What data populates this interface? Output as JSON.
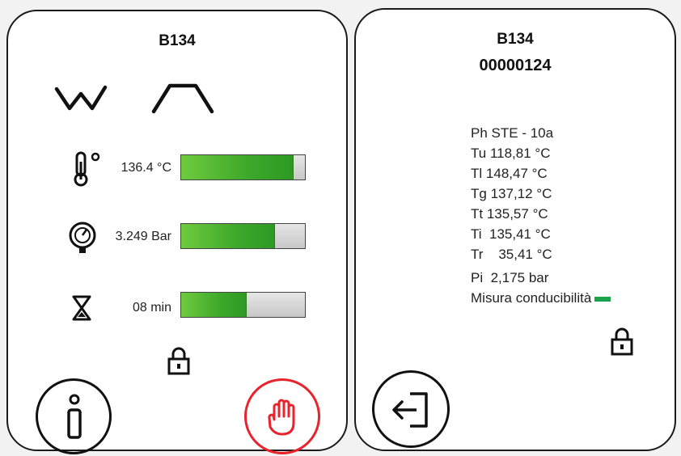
{
  "left_panel": {
    "title": "B134",
    "temperature": {
      "value_text": "136.4 °C",
      "level": 0.9
    },
    "pressure": {
      "value_text": "3.249 Bar",
      "level": 0.75
    },
    "time": {
      "value_text": "08 min",
      "level": 0.52
    },
    "icons": {
      "cycle_wave": "wave-icon",
      "cycle_profile": "trapezoid-profile-icon",
      "thermometer": "thermometer-icon",
      "manometer": "pressure-gauge-icon",
      "hourglass": "hourglass-icon",
      "lock": "padlock-icon",
      "info": "info-icon",
      "stop": "stop-hand-icon"
    },
    "colors": {
      "stop_red": "#e8232c",
      "bar_green": "#3da82a"
    }
  },
  "right_panel": {
    "title": "B134",
    "cycle_number": "00000124",
    "rows": [
      {
        "label": "Ph",
        "value": "STE - 10a"
      },
      {
        "label": "Tu",
        "value": "118,81 °C"
      },
      {
        "label": "Tl",
        "value": "148,47 °C"
      },
      {
        "label": "Tg",
        "value": "137,12 °C"
      },
      {
        "label": "Tt",
        "value": "135,57 °C"
      },
      {
        "label": "Ti",
        "value": " 135,41 °C"
      },
      {
        "label": "Tr",
        "value": "   35,41 °C"
      },
      {
        "label": "Pi",
        "value": " 2,175 bar"
      }
    ],
    "conductivity_label": "Misura conducibilità",
    "icons": {
      "lock": "padlock-icon",
      "exit": "exit-icon"
    },
    "colors": {
      "conductivity_ok": "#1aa34a"
    }
  }
}
